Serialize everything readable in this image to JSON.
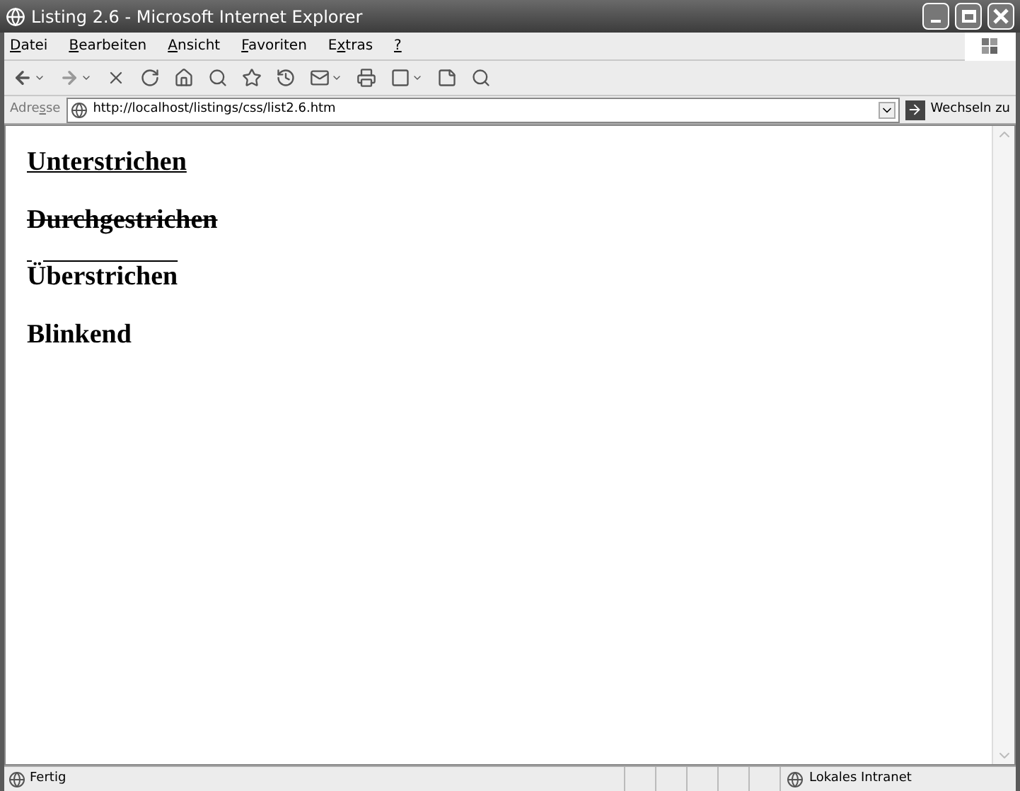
{
  "window": {
    "title": "Listing 2.6 - Microsoft Internet Explorer"
  },
  "menu": [
    {
      "key": "D",
      "post": "atei"
    },
    {
      "key": "B",
      "post": "earbeiten"
    },
    {
      "key": "A",
      "post": "nsicht"
    },
    {
      "key": "F",
      "post": "avoriten"
    },
    {
      "pre": "E",
      "key": "x",
      "post": "tras"
    },
    {
      "key": "?"
    }
  ],
  "address_bar": {
    "label": {
      "pre": "Adre",
      "key": "s",
      "post": "se"
    },
    "value": "http://localhost/listings/css/list2.6.htm",
    "go_button": "Wechseln zu"
  },
  "content": [
    {
      "kind": "underline",
      "text": "Unterstrichen"
    },
    {
      "kind": "line-through",
      "text": "Durchgestrichen"
    },
    {
      "kind": "overline",
      "text": "Überstrichen"
    },
    {
      "kind": "blink",
      "text": "Blinkend"
    }
  ],
  "status_bar": {
    "status": "Fertig",
    "zone": "Lokales Intranet"
  }
}
